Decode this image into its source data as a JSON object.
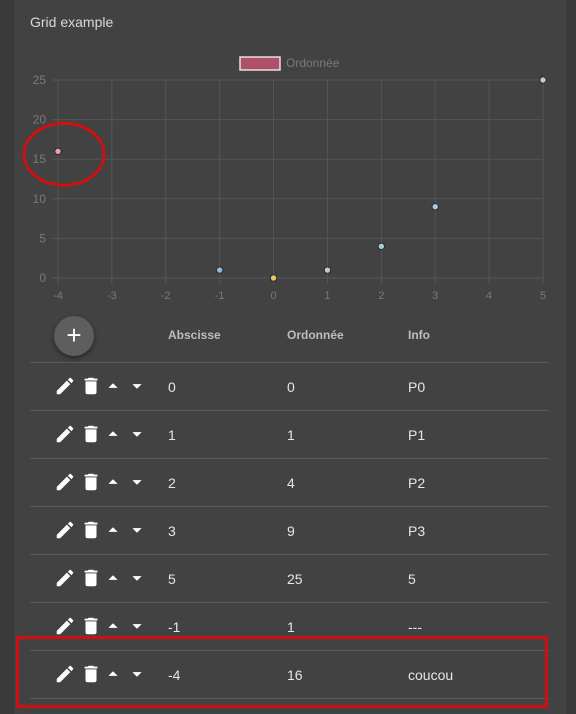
{
  "panel": {
    "title": "Grid example"
  },
  "chart_data": {
    "type": "scatter",
    "series": [
      {
        "name": "Ordonnée",
        "points": [
          {
            "x": -4,
            "y": 16,
            "color": "#e8a0b0"
          },
          {
            "x": -1,
            "y": 1,
            "color": "#8fbce0"
          },
          {
            "x": 0,
            "y": 0,
            "color": "#e8c96a"
          },
          {
            "x": 1,
            "y": 1,
            "color": "#c8c8c8"
          },
          {
            "x": 2,
            "y": 4,
            "color": "#9fd0d8"
          },
          {
            "x": 3,
            "y": 9,
            "color": "#b0c8e0"
          },
          {
            "x": 5,
            "y": 25,
            "color": "#c8c8c8"
          }
        ]
      }
    ],
    "xlim": [
      -4,
      5
    ],
    "ylim": [
      0,
      25
    ],
    "xticks": [
      "-4",
      "-3",
      "-2",
      "-1",
      "0",
      "1",
      "2",
      "3",
      "4",
      "5"
    ],
    "yticks": [
      "0",
      "5",
      "10",
      "15",
      "20",
      "25"
    ],
    "legend": "top",
    "legend_color": "#b05068",
    "grid": true,
    "annotation_color": "#d01010"
  },
  "table": {
    "add_label": "+",
    "headers": {
      "x": "Abscisse",
      "y": "Ordonnée",
      "info": "Info"
    },
    "rows": [
      {
        "x": "0",
        "y": "0",
        "info": "P0"
      },
      {
        "x": "1",
        "y": "1",
        "info": "P1"
      },
      {
        "x": "2",
        "y": "4",
        "info": "P2"
      },
      {
        "x": "3",
        "y": "9",
        "info": "P3"
      },
      {
        "x": "5",
        "y": "25",
        "info": "5"
      },
      {
        "x": "-1",
        "y": "1",
        "info": "---"
      },
      {
        "x": "-4",
        "y": "16",
        "info": "coucou"
      }
    ],
    "row_actions": [
      "edit-icon",
      "delete-icon",
      "move-up-icon",
      "move-down-icon"
    ]
  }
}
